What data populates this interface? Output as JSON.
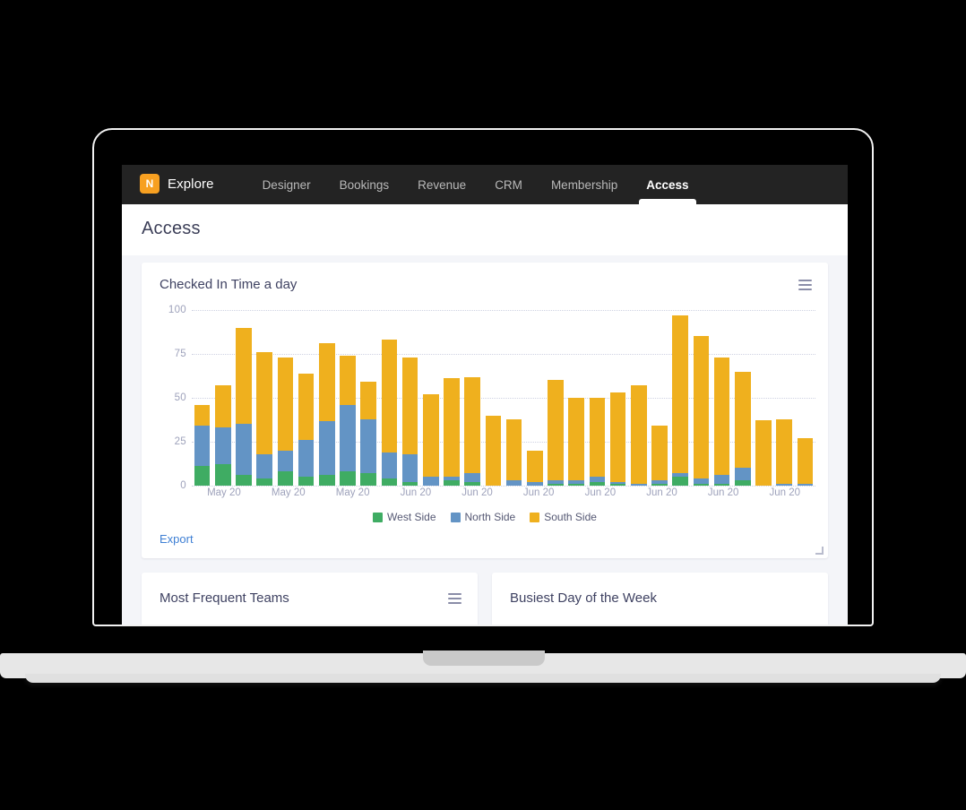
{
  "brand": {
    "logo_letter": "N",
    "name": "Explore"
  },
  "nav": [
    {
      "label": "Designer",
      "active": false
    },
    {
      "label": "Bookings",
      "active": false
    },
    {
      "label": "Revenue",
      "active": false
    },
    {
      "label": "CRM",
      "active": false
    },
    {
      "label": "Membership",
      "active": false
    },
    {
      "label": "Access",
      "active": true
    }
  ],
  "page": {
    "title": "Access"
  },
  "chart_card": {
    "title": "Checked In Time a day",
    "menu_icon": "hamburger-icon",
    "export_label": "Export"
  },
  "bottom_cards": [
    {
      "title": "Most Frequent Teams",
      "menu_icon": "hamburger-icon"
    },
    {
      "title": "Busiest Day of the Week",
      "menu_icon": ""
    }
  ],
  "colors": {
    "west_side": "#3FAC63",
    "north_side": "#6394C5",
    "south_side": "#EFB01E",
    "brand_orange": "#F7A021",
    "link_blue": "#3E7FD4",
    "topbar": "#232323",
    "page_bg": "#F4F5F9",
    "title_text": "#3C3F58"
  },
  "chart_data": {
    "type": "bar",
    "stacked": true,
    "title": "Checked In Time a day",
    "xlabel": "",
    "ylabel": "",
    "ylim": [
      0,
      100
    ],
    "yticks": [
      0,
      25,
      50,
      75,
      100
    ],
    "grid": true,
    "legend_position": "bottom",
    "tick_labels": [
      "May 20",
      "May 20",
      "May 20",
      "Jun 20",
      "Jun 20",
      "Jun 20",
      "Jun 20",
      "Jun 20",
      "Jun 20",
      "Jun 20"
    ],
    "tick_every": 3,
    "categories": [
      "1",
      "2",
      "3",
      "4",
      "5",
      "6",
      "7",
      "8",
      "9",
      "10",
      "11",
      "12",
      "13",
      "14",
      "15",
      "16",
      "17",
      "18",
      "19",
      "20",
      "21",
      "22",
      "23",
      "24",
      "25",
      "26",
      "27",
      "28",
      "29",
      "30"
    ],
    "series": [
      {
        "name": "West Side",
        "color": "#3FAC63",
        "values": [
          11,
          12,
          6,
          4,
          8,
          5,
          6,
          8,
          7,
          4,
          2,
          0,
          3,
          2,
          0,
          0,
          0,
          1,
          1,
          2,
          1,
          0,
          1,
          5,
          1,
          1,
          3,
          0,
          0,
          0
        ]
      },
      {
        "name": "North Side",
        "color": "#6394C5",
        "values": [
          23,
          21,
          29,
          14,
          12,
          21,
          31,
          38,
          31,
          15,
          16,
          5,
          2,
          5,
          0,
          3,
          2,
          2,
          2,
          3,
          1,
          1,
          2,
          2,
          3,
          5,
          7,
          0,
          1,
          1
        ]
      },
      {
        "name": "South Side",
        "color": "#EFB01E",
        "values": [
          12,
          24,
          55,
          58,
          53,
          38,
          44,
          28,
          21,
          64,
          55,
          47,
          56,
          55,
          40,
          35,
          18,
          57,
          47,
          45,
          51,
          56,
          31,
          90,
          81,
          67,
          55,
          37,
          37,
          26
        ]
      }
    ],
    "totals": [
      46,
      57,
      90,
      76,
      73,
      64,
      81,
      74,
      59,
      83,
      73,
      52,
      61,
      62,
      40,
      38,
      20,
      60,
      50,
      50,
      53,
      57,
      34,
      97,
      85,
      73,
      65,
      37,
      38,
      27
    ]
  }
}
